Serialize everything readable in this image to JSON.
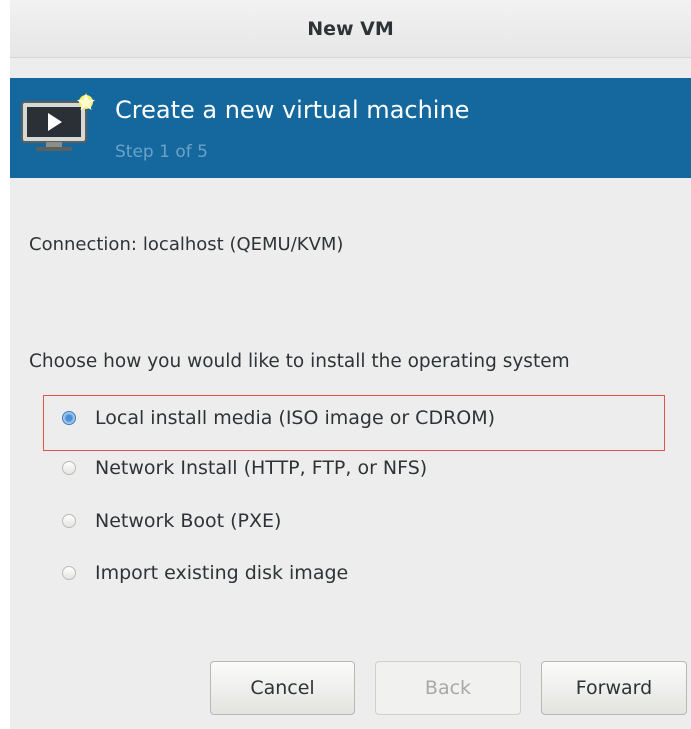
{
  "window": {
    "title": "New VM"
  },
  "banner": {
    "title": "Create a new virtual machine",
    "step": "Step 1 of 5",
    "icon": "monitor-play-icon"
  },
  "connection": {
    "label": "Connection:",
    "value": "localhost (QEMU/KVM)"
  },
  "install": {
    "prompt": "Choose how you would like to install the operating system",
    "selected_index": 0,
    "options": [
      {
        "label": "Local install media (ISO image or CDROM)",
        "checked": true
      },
      {
        "label": "Network Install (HTTP, FTP, or NFS)",
        "checked": false
      },
      {
        "label": "Network Boot (PXE)",
        "checked": false
      },
      {
        "label": "Import existing disk image",
        "checked": false
      }
    ]
  },
  "buttons": {
    "cancel": "Cancel",
    "back": "Back",
    "forward": "Forward",
    "back_enabled": false
  },
  "colors": {
    "banner_bg": "#15689e",
    "highlight_border": "#e0524e",
    "radio_checked": "#4a90d9"
  }
}
